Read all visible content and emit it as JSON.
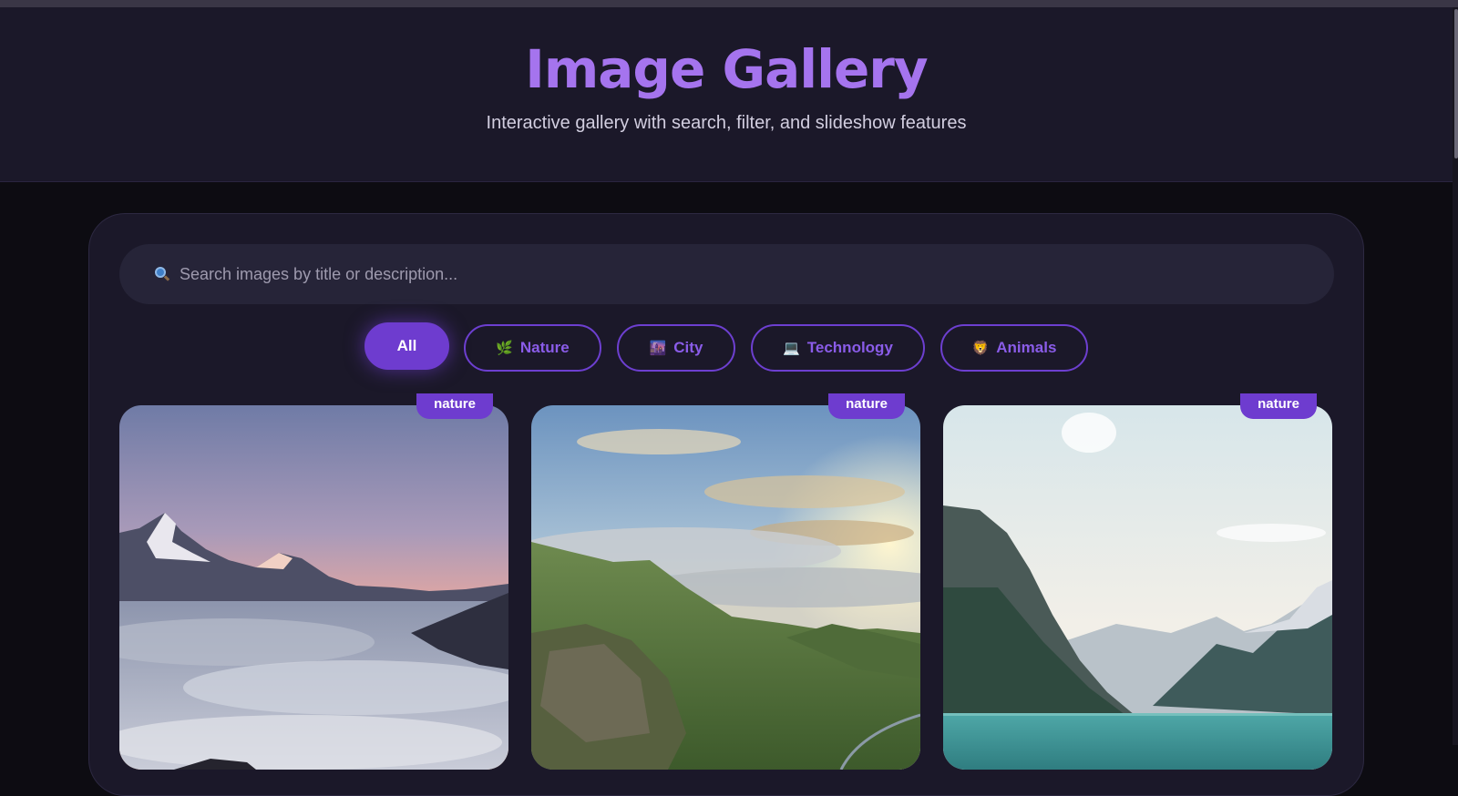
{
  "header": {
    "title": "Image Gallery",
    "subtitle": "Interactive gallery with search, filter, and slideshow features"
  },
  "search": {
    "icon": "search-icon",
    "placeholder": "Search images by title or description...",
    "value": ""
  },
  "filters": [
    {
      "label": "All",
      "emoji": "",
      "active": true
    },
    {
      "label": "Nature",
      "emoji": "🌿",
      "active": false
    },
    {
      "label": "City",
      "emoji": "🌆",
      "active": false
    },
    {
      "label": "Technology",
      "emoji": "💻",
      "active": false
    },
    {
      "label": "Animals",
      "emoji": "🦁",
      "active": false
    }
  ],
  "cards": [
    {
      "category": "nature",
      "image": "mountain peaks above sea of clouds at sunset"
    },
    {
      "category": "nature",
      "image": "green valley with clouds and sunburst"
    },
    {
      "category": "nature",
      "image": "turquoise mountain lake with steep cliffs"
    }
  ],
  "colors": {
    "accent": "#a574ee",
    "chip_active": "#6e3ccf",
    "panel": "#1b1829",
    "page_bg": "#0d0c12"
  }
}
